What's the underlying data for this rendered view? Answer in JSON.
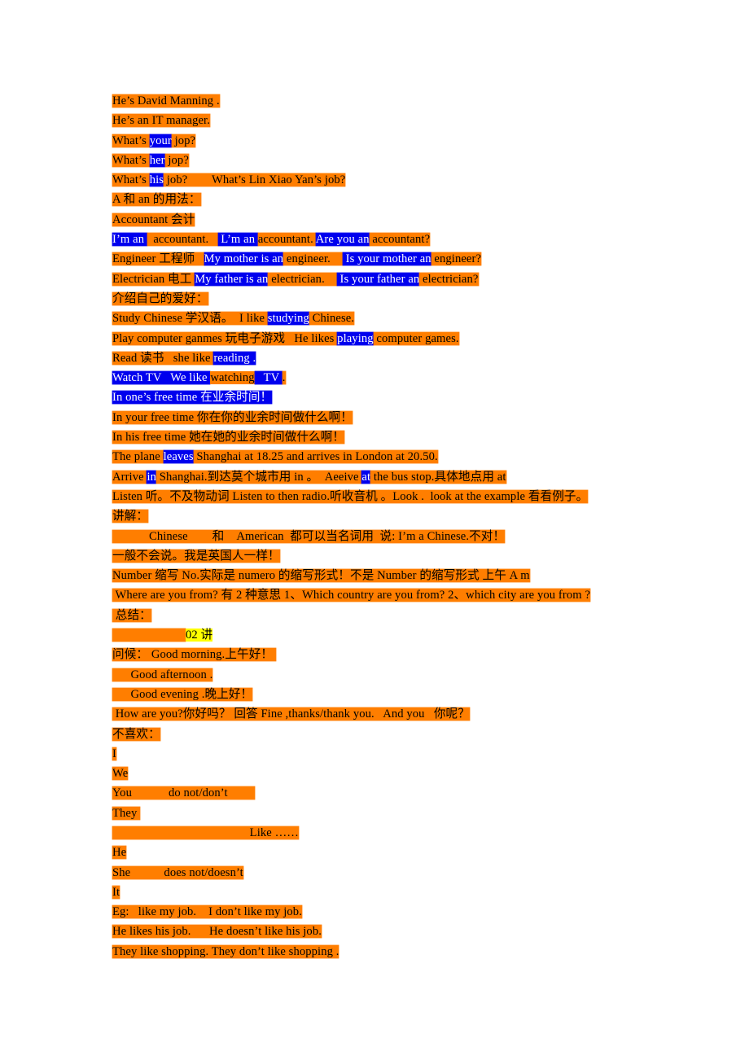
{
  "document": {
    "title": "English Lesson Notes",
    "colors": {
      "orange_highlight": "#FF7E00",
      "blue_highlight": "#0000EE",
      "yellow_highlight": "#FFFF00",
      "text": "#000000",
      "inverse_text": "#FFFFFF",
      "page_background": "#FFFFFF"
    },
    "lines": [
      {
        "id": "l01",
        "runs": [
          {
            "t": "He’s David Manning .",
            "h": "orange"
          }
        ]
      },
      {
        "id": "l02",
        "runs": [
          {
            "t": "He’s an IT manager.",
            "h": "orange"
          }
        ]
      },
      {
        "id": "l03",
        "runs": [
          {
            "t": "What’s ",
            "h": "orange"
          },
          {
            "t": "your",
            "h": "blue"
          },
          {
            "t": " jop?",
            "h": "orange"
          }
        ]
      },
      {
        "id": "l04",
        "runs": [
          {
            "t": "What’s ",
            "h": "orange"
          },
          {
            "t": "her",
            "h": "blue"
          },
          {
            "t": " jop?",
            "h": "orange"
          }
        ]
      },
      {
        "id": "l05",
        "runs": [
          {
            "t": "What’s ",
            "h": "orange"
          },
          {
            "t": "his",
            "h": "blue"
          },
          {
            "t": " job?        What’s Lin Xiao Yan’s job?",
            "h": "orange"
          }
        ]
      },
      {
        "id": "l06",
        "runs": [
          {
            "t": "A 和 an 的用法：",
            "h": "orange"
          }
        ]
      },
      {
        "id": "l07",
        "runs": [
          {
            "t": "Accountant 会计",
            "h": "orange"
          }
        ]
      },
      {
        "id": "l08",
        "runs": [
          {
            "t": "I’m an ",
            "h": "blue"
          },
          {
            "t": "  accountant.   ",
            "h": "orange"
          },
          {
            "t": " L’m an ",
            "h": "blue"
          },
          {
            "t": "accountant. ",
            "h": "orange"
          },
          {
            "t": "Are you an",
            "h": "blue"
          },
          {
            "t": " accountant?",
            "h": "orange"
          }
        ]
      },
      {
        "id": "l09",
        "runs": [
          {
            "t": "Engineer 工程师   ",
            "h": "orange"
          },
          {
            "t": "My mother is an",
            "h": "blue"
          },
          {
            "t": " engineer.    ",
            "h": "orange"
          },
          {
            "t": " Is your mother an",
            "h": "blue"
          },
          {
            "t": " engineer?",
            "h": "orange"
          }
        ]
      },
      {
        "id": "l10",
        "runs": [
          {
            "t": "Electrician 电工 ",
            "h": "orange"
          },
          {
            "t": "My father is an",
            "h": "blue"
          },
          {
            "t": " electrician.    ",
            "h": "orange"
          },
          {
            "t": " Is your father an",
            "h": "blue"
          },
          {
            "t": " electrician?",
            "h": "orange"
          }
        ]
      },
      {
        "id": "l11",
        "runs": [
          {
            "t": "介绍自己的爱好：",
            "h": "orange"
          }
        ]
      },
      {
        "id": "l12",
        "runs": [
          {
            "t": "Study Chinese 学汉语。  I like ",
            "h": "orange"
          },
          {
            "t": "studying",
            "h": "blue"
          },
          {
            "t": " Chinese.",
            "h": "orange"
          }
        ]
      },
      {
        "id": "l13",
        "runs": [
          {
            "t": "Play computer ganmes 玩电子游戏   He likes ",
            "h": "orange"
          },
          {
            "t": "playing",
            "h": "blue"
          },
          {
            "t": " computer games.",
            "h": "orange"
          }
        ]
      },
      {
        "id": "l14",
        "runs": [
          {
            "t": "Read 读书   she like ",
            "h": "orange"
          },
          {
            "t": "reading .",
            "h": "blue"
          }
        ]
      },
      {
        "id": "l15",
        "runs": [
          {
            "t": "Watch TV   We like ",
            "h": "blue"
          },
          {
            "t": "watching",
            "h": "orange-on-blue"
          },
          {
            "t": "   TV ",
            "h": "blue"
          },
          {
            "t": ".",
            "h": "orange"
          }
        ]
      },
      {
        "id": "l16",
        "runs": [
          {
            "t": "In one’s free time 在业余时间！",
            "h": "blue"
          }
        ]
      },
      {
        "id": "l17",
        "runs": [
          {
            "t": "In your free time 你在你的业余时间做什么啊！",
            "h": "orange"
          }
        ]
      },
      {
        "id": "l18",
        "runs": [
          {
            "t": "In his free time 她在她的业余时间做什么啊！",
            "h": "orange"
          }
        ]
      },
      {
        "id": "l19",
        "runs": [
          {
            "t": "The plane ",
            "h": "orange"
          },
          {
            "t": "leaves",
            "h": "blue"
          },
          {
            "t": " Shanghai at 18.25 and arrives in London at 20.50.",
            "h": "orange"
          }
        ]
      },
      {
        "id": "l20",
        "runs": [
          {
            "t": "Arrive ",
            "h": "orange"
          },
          {
            "t": "in",
            "h": "blue"
          },
          {
            "t": " Shanghai.到达莫个城市用 in 。  Aeeive ",
            "h": "orange"
          },
          {
            "t": "at",
            "h": "blue"
          },
          {
            "t": " the bus stop.具体地点用 at",
            "h": "orange"
          }
        ]
      },
      {
        "id": "l21",
        "runs": [
          {
            "t": "Listen 听。不及物动词 Listen to then radio.听收音机 。Look .  look at the example 看看例子。",
            "h": "orange"
          }
        ]
      },
      {
        "id": "l22",
        "runs": [
          {
            "t": "讲解：",
            "h": "orange"
          }
        ]
      },
      {
        "id": "l23",
        "runs": [
          {
            "t": "            Chinese        和    American  都可以当名词用  说: I’m a Chinese.不对！",
            "h": "orange"
          }
        ]
      },
      {
        "id": "l24",
        "runs": [
          {
            "t": "一般不会说。我是英国人一样！",
            "h": "orange"
          }
        ]
      },
      {
        "id": "l25",
        "runs": [
          {
            "t": "Number 缩写 No.实际是 numero 的缩写形式！不是 Number 的缩写形式 上午 A m",
            "h": "orange"
          }
        ]
      },
      {
        "id": "l26",
        "runs": [
          {
            "t": " Where are you from? 有 2 种意思 1、Which country are you from? 2、which city are you from ?",
            "h": "orange"
          }
        ]
      },
      {
        "id": "l27",
        "runs": [
          {
            "t": " 总结：",
            "h": "orange"
          }
        ]
      },
      {
        "id": "l28",
        "runs": [
          {
            "t": "                        ",
            "h": "orange"
          },
          {
            "t": "02 讲",
            "h": "yellow"
          }
        ]
      },
      {
        "id": "l29",
        "runs": [
          {
            "t": "问候： Good morning.上午好！ ",
            "h": "orange"
          }
        ]
      },
      {
        "id": "l30",
        "runs": [
          {
            "t": "      Good afternoon .",
            "h": "orange"
          }
        ]
      },
      {
        "id": "l31",
        "runs": [
          {
            "t": "      Good evening .晚上好！",
            "h": "orange"
          }
        ]
      },
      {
        "id": "l32",
        "runs": [
          {
            "t": " How are you?你好吗？ 回答 Fine ,thanks/thank you.   And you   你呢？",
            "h": "orange"
          }
        ]
      },
      {
        "id": "l33",
        "runs": [
          {
            "t": "不喜欢：",
            "h": "orange"
          }
        ]
      },
      {
        "id": "l34",
        "runs": [
          {
            "t": "I",
            "h": "orange"
          }
        ]
      },
      {
        "id": "l35",
        "runs": [
          {
            "t": "We",
            "h": "orange"
          }
        ]
      },
      {
        "id": "l36",
        "runs": [
          {
            "t": "You            do not/don’t         ",
            "h": "orange"
          }
        ]
      },
      {
        "id": "l37",
        "runs": [
          {
            "t": "They ",
            "h": "orange"
          }
        ]
      },
      {
        "id": "l38",
        "runs": [
          {
            "t": "                                             Like ……",
            "h": "orange"
          }
        ]
      },
      {
        "id": "l39",
        "runs": [
          {
            "t": "He",
            "h": "orange"
          }
        ]
      },
      {
        "id": "l40",
        "runs": [
          {
            "t": "She           does not/doesn’t",
            "h": "orange"
          }
        ]
      },
      {
        "id": "l41",
        "runs": [
          {
            "t": "It",
            "h": "orange"
          }
        ]
      },
      {
        "id": "l42",
        "runs": [
          {
            "t": "Eg:   like my job.    I don’t like my job.",
            "h": "orange"
          }
        ]
      },
      {
        "id": "l43",
        "runs": [
          {
            "t": "He likes his job.      He doesn’t like his job.",
            "h": "orange"
          }
        ]
      },
      {
        "id": "l44",
        "runs": [
          {
            "t": "They like shopping. They don’t like shopping .",
            "h": "orange"
          }
        ]
      }
    ]
  }
}
